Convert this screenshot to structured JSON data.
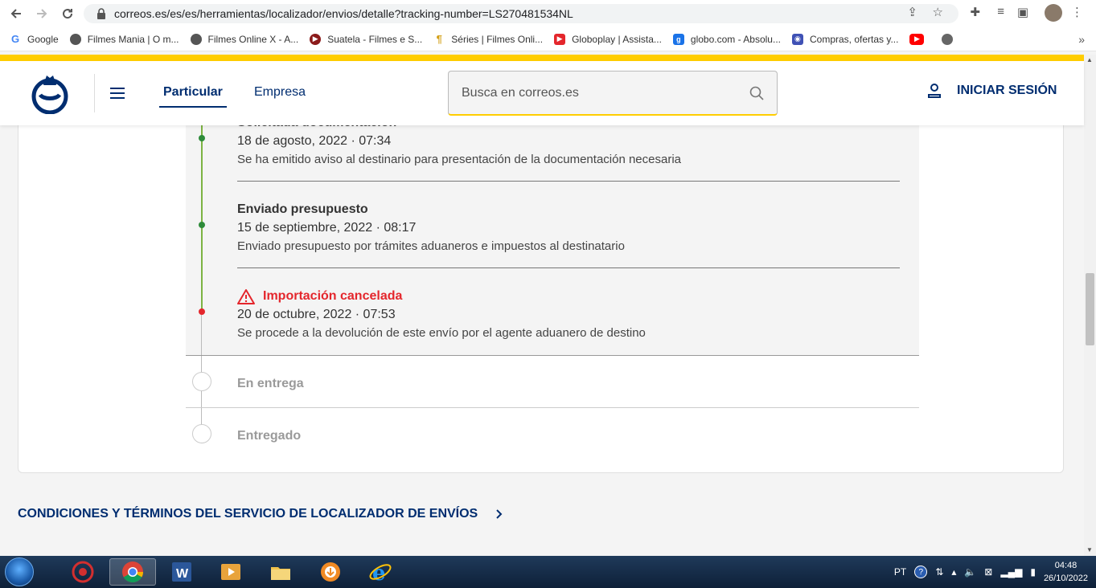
{
  "browser": {
    "url": "correos.es/es/es/herramientas/localizador/envios/detalle?tracking-number=LS270481534NL",
    "bookmarks": [
      {
        "label": "Google",
        "color": "#4285f4"
      },
      {
        "label": "Filmes Mania | O m...",
        "color": "#555555"
      },
      {
        "label": "Filmes Online X - A...",
        "color": "#555555"
      },
      {
        "label": "Suatela - Filmes e S...",
        "color": "#8b1a1a"
      },
      {
        "label": "Séries | Filmes Onli...",
        "color": "#d4a017"
      },
      {
        "label": "Globoplay | Assista...",
        "color": "#e4262c"
      },
      {
        "label": "globo.com - Absolu...",
        "color": "#1a73e8"
      },
      {
        "label": "Compras, ofertas y...",
        "color": "#3f51b5"
      },
      {
        "label": "",
        "color": "#ff0000"
      },
      {
        "label": "",
        "color": "#666666"
      }
    ],
    "more_bookmarks": "»"
  },
  "header": {
    "tab_particular": "Particular",
    "tab_empresa": "Empresa",
    "search_placeholder": "Busca en correos.es",
    "login_label": "INICIAR SESIÓN"
  },
  "tracking": {
    "events": [
      {
        "title": "Solicitada documentación",
        "date": "18 de agosto, 2022 · 07:34",
        "description": "Se ha emitido aviso al destinario para presentación de la documentación necesaria",
        "status": "done"
      },
      {
        "title": "Enviado presupuesto",
        "date": "15 de septiembre, 2022 · 08:17",
        "description": "Enviado presupuesto por trámites aduaneros e impuestos al destinatario",
        "status": "done"
      },
      {
        "title": "Importación cancelada",
        "date": "20 de octubre, 2022 · 07:53",
        "description": "Se procede a la devolución de este envío por el agente aduanero de destino",
        "status": "error"
      }
    ],
    "pending_steps": [
      "En entrega",
      "Entregado"
    ]
  },
  "footer": {
    "conditions_link": "CONDICIONES Y TÉRMINOS DEL SERVICIO DE LOCALIZADOR DE ENVÍOS"
  },
  "taskbar": {
    "language": "PT",
    "time": "04:48",
    "date": "26/10/2022"
  },
  "colors": {
    "brand_blue": "#002d70",
    "brand_yellow": "#ffcd00",
    "done_green": "#7cb342",
    "error_red": "#e4262c"
  }
}
